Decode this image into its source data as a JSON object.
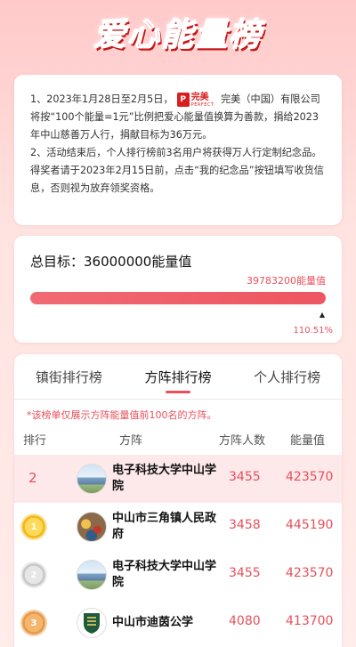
{
  "banner": {
    "title": "爱心能量榜"
  },
  "info": {
    "p1_before": "1、2023年1月28日至2月5日，",
    "logo_cn": "完美",
    "logo_en": "PERFECT",
    "p1_after": " 完美（中国）有限公司将按“100个能量=1元”比例把爱心能量值换算为善款，捐给2023年中山慈善万人行，捐献目标为36万元。",
    "p2": "2、活动结束后，个人排行榜前3名用户将获得万人行定制纪念品。得奖者请于2023年2月15日前，点击“我的纪念品”按钮填写收货信息，否则视为放弃领奖资格。"
  },
  "goal": {
    "title": "总目标：36000000能量值",
    "current": "39783200能量值",
    "progress_fraction": 1.0,
    "percent_label": "110.51%",
    "marker": "▲"
  },
  "ranking": {
    "tabs": [
      {
        "label": "镇街排行榜",
        "active": false
      },
      {
        "label": "方阵排行榜",
        "active": true
      },
      {
        "label": "个人排行榜",
        "active": false
      }
    ],
    "note": "*该榜单仅展示方阵能量值前100名的方阵。",
    "headers": {
      "rank": "排行",
      "team": "方阵",
      "people": "方阵人数",
      "energy": "能量值"
    },
    "rows": [
      {
        "rank": "2",
        "medal": "",
        "name": "电子科技大学中山学院",
        "people": "3455",
        "energy": "423570",
        "highlight": true,
        "avatar": "campus-photo"
      },
      {
        "rank": "1",
        "medal": "gold",
        "name": "中山市三角镇人民政府",
        "people": "3458",
        "energy": "445190",
        "highlight": false,
        "avatar": "crowd-photo"
      },
      {
        "rank": "2",
        "medal": "silver",
        "name": "电子科技大学中山学院",
        "people": "3455",
        "energy": "423570",
        "highlight": false,
        "avatar": "campus-photo"
      },
      {
        "rank": "3",
        "medal": "bronze",
        "name": "中山市迪茵公学",
        "people": "4080",
        "energy": "413700",
        "highlight": false,
        "avatar": "school-crest"
      }
    ]
  },
  "colors": {
    "accent": "#e8505b",
    "gold": "#f3b81b",
    "silver": "#c9c9c9",
    "bronze": "#e79a4a"
  }
}
